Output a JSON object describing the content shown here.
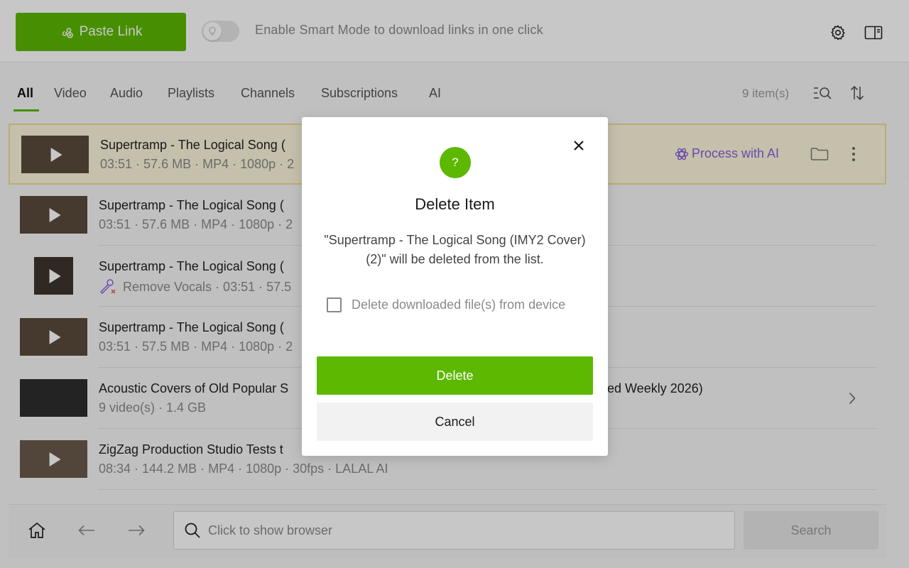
{
  "header": {
    "paste_label": "Paste Link",
    "smart_mode_text": "Enable Smart Mode to download links in one click"
  },
  "tabs": {
    "items": [
      "All",
      "Video",
      "Audio",
      "Playlists",
      "Channels",
      "Subscriptions",
      "AI"
    ],
    "active": "All",
    "item_count": "9 item(s)"
  },
  "list": [
    {
      "title": "Supertramp - The Logical Song (",
      "subtitle": "03:51 · 57.6 MB · MP4 · 1080p · 2",
      "action": "Process with AI"
    },
    {
      "title": "Supertramp - The Logical Song (",
      "subtitle": "03:51 · 57.6 MB · MP4 · 1080p · 2"
    },
    {
      "title": "Supertramp - The Logical Song (",
      "subtitle": "Remove Vocals · 03:51 · 57.5"
    },
    {
      "title": "Supertramp - The Logical Song (",
      "subtitle": "03:51 · 57.5 MB · MP4 · 1080p · 2"
    },
    {
      "title": "Acoustic Covers of Old Popular S",
      "title_end": "ed Weekly 2026)",
      "subtitle": "9 video(s) · 1.4 GB"
    },
    {
      "title": "ZigZag Production Studio Tests t",
      "subtitle": "08:34 · 144.2 MB · MP4 · 1080p · 30fps · LALAL AI"
    }
  ],
  "bottom": {
    "browse_placeholder": "Click to show browser",
    "search_label": "Search"
  },
  "dialog": {
    "icon": "?",
    "title": "Delete Item",
    "message": "\"Supertramp - The Logical Song (IMY2 Cover) (2)\" will be deleted from the list.",
    "checkbox_label": "Delete downloaded file(s) from device",
    "delete_label": "Delete",
    "cancel_label": "Cancel"
  },
  "colors": {
    "accent": "#5cb800",
    "ai_purple": "#8a5ee0",
    "selected_row": "#fdf6dc"
  }
}
